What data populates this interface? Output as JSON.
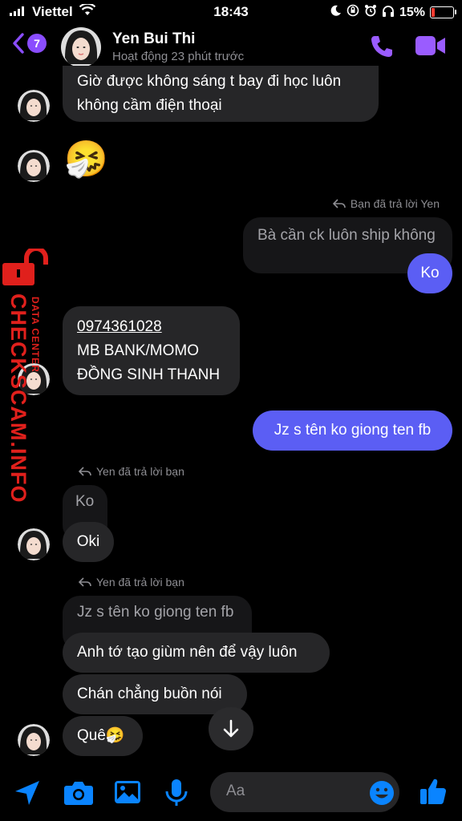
{
  "status_bar": {
    "carrier": "Viettel",
    "time": "18:43",
    "battery": "15%",
    "battery_level": 0.15
  },
  "header": {
    "unread_count": "7",
    "contact_name": "Yen Bui Thi",
    "status": "Hoạt động 23 phút trước"
  },
  "messages": [
    {
      "line1": "Giờ được không sáng t bay đi học luôn",
      "line2": "không cầm điện thoại"
    },
    {
      "emoji": "🤧"
    },
    {
      "reply_note": "Bạn đã trả lời Yen",
      "quoted": "Bà cần ck luôn ship không",
      "text": "Ko"
    },
    {
      "line1": "0974361028",
      "line2": "MB BANK/MOMO",
      "line3": "ĐỒNG SINH THANH"
    },
    {
      "text": "Jz s tên ko giong ten fb"
    },
    {
      "reply_note": "Yen đã trả lời bạn",
      "quoted": "Ko",
      "text": "Oki"
    },
    {
      "reply_note": "Yen đã trả lời bạn",
      "quoted": "Jz s tên ko giong ten fb",
      "text1": "Anh tớ tạo giùm nên để vậy luôn",
      "text2": "Chán chẳng buồn nói",
      "text3": "Quê🤧"
    }
  ],
  "watermark": {
    "brand": "CHECKSCAM.INFO",
    "sub": "DATA CENTER"
  },
  "composer": {
    "placeholder": "Aa"
  },
  "colors": {
    "accent": "#8a4dff",
    "outgoing": "#5b5ef4",
    "composer_icons": "#0a84ff",
    "watermark": "#e0201c"
  }
}
